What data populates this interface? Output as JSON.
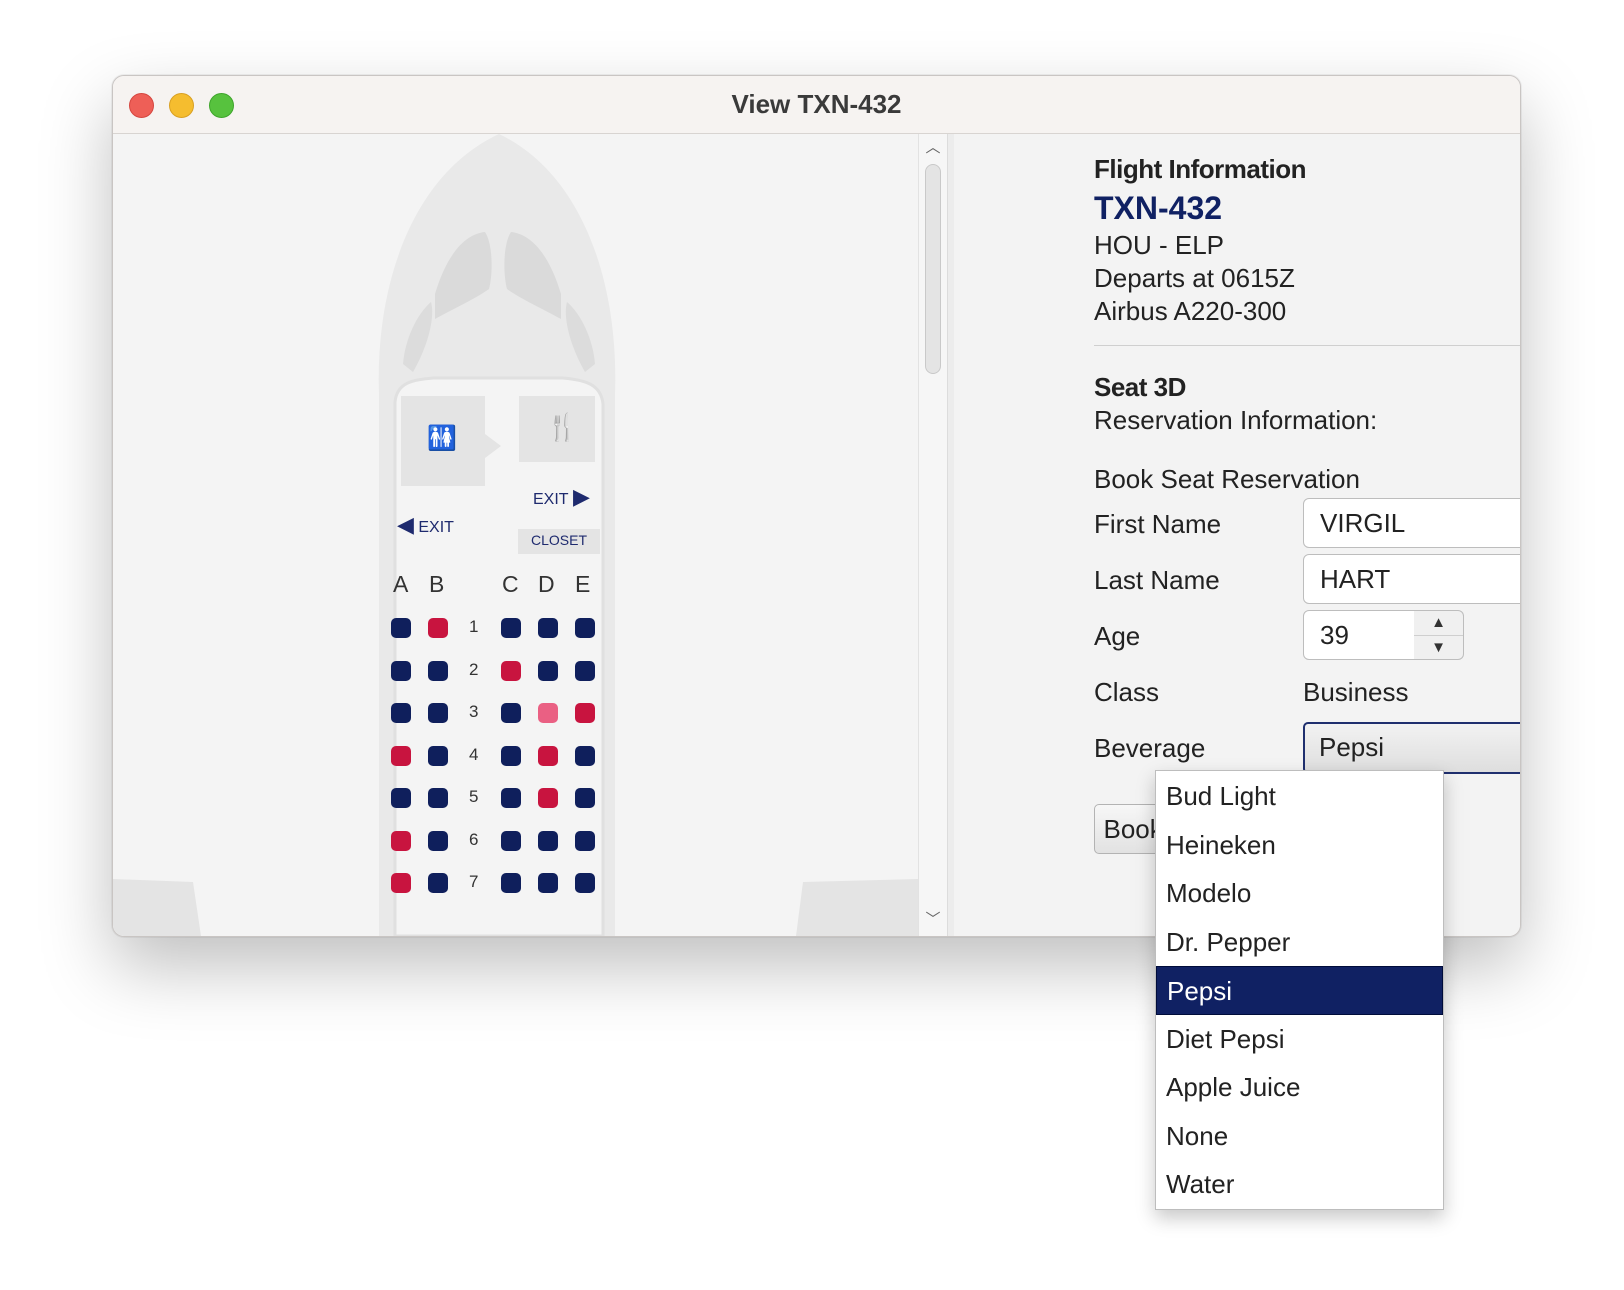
{
  "window": {
    "title": "View TXN-432"
  },
  "seat_map": {
    "columns_left": [
      "A",
      "B"
    ],
    "columns_right": [
      "C",
      "D",
      "E"
    ],
    "rows": [
      {
        "num": "1",
        "seats": {
          "A": "available",
          "B": "occupied",
          "C": "available",
          "D": "available",
          "E": "available"
        }
      },
      {
        "num": "2",
        "seats": {
          "A": "available",
          "B": "available",
          "C": "occupied",
          "D": "available",
          "E": "available"
        }
      },
      {
        "num": "3",
        "seats": {
          "A": "available",
          "B": "available",
          "C": "available",
          "D": "selected",
          "E": "occupied"
        }
      },
      {
        "num": "4",
        "seats": {
          "A": "occupied",
          "B": "available",
          "C": "available",
          "D": "occupied",
          "E": "available"
        }
      },
      {
        "num": "5",
        "seats": {
          "A": "available",
          "B": "available",
          "C": "available",
          "D": "occupied",
          "E": "available"
        }
      },
      {
        "num": "6",
        "seats": {
          "A": "occupied",
          "B": "available",
          "C": "available",
          "D": "available",
          "E": "available"
        }
      },
      {
        "num": "7",
        "seats": {
          "A": "occupied",
          "B": "available",
          "C": "available",
          "D": "available",
          "E": "available"
        }
      }
    ],
    "facilities": {
      "exit_left": "EXIT",
      "exit_right": "EXIT",
      "closet": "CLOSET",
      "restroom_icon": "restroom-icon",
      "galley_icon": "fork-knife-icon"
    },
    "colors": {
      "available": "#0f1f5c",
      "occupied": "#c8143f",
      "selected": "#ea6083"
    }
  },
  "flight": {
    "heading": "Flight Information",
    "code": "TXN-432",
    "route": "HOU - ELP",
    "departs": "Departs at 0615Z",
    "aircraft": "Airbus A220-300"
  },
  "seat": {
    "title": "Seat 3D",
    "reservation_info": "Reservation Information:",
    "book_heading": "Book Seat Reservation"
  },
  "form": {
    "first_name_label": "First Name",
    "first_name_value": "VIRGIL",
    "last_name_label": "Last Name",
    "last_name_value": "HART",
    "age_label": "Age",
    "age_value": "39",
    "class_label": "Class",
    "class_value": "Business",
    "beverage_label": "Beverage",
    "beverage_value": "Pepsi",
    "book_button": "Book Seat"
  },
  "beverage_options": [
    "Bud Light",
    "Heineken",
    "Modelo",
    "Dr. Pepper",
    "Pepsi",
    "Diet Pepsi",
    "Apple Juice",
    "None",
    "Water"
  ],
  "beverage_selected_index": 4
}
